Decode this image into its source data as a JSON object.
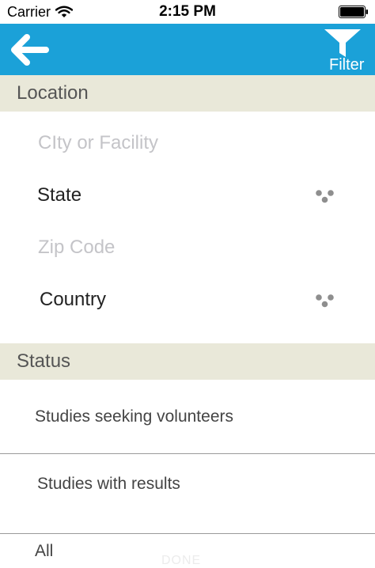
{
  "status_bar": {
    "carrier": "Carrier",
    "time": "2:15 PM"
  },
  "nav": {
    "back_icon": "back-arrow-icon",
    "filter_icon": "funnel-icon",
    "filter_label": "Filter",
    "bar_color": "#1ba1d8"
  },
  "location": {
    "header": "Location",
    "city_placeholder": "CIty or Facility",
    "state_label": "State",
    "zip_placeholder": "Zip Code",
    "country_label": "Country"
  },
  "status": {
    "header": "Status",
    "options": [
      "Studies seeking volunteers",
      "Studies with results",
      "All"
    ]
  },
  "footer": {
    "done_label": "DONE"
  },
  "colors": {
    "section_header_bg": "#e9e8d9",
    "placeholder": "#c4c4c8"
  }
}
